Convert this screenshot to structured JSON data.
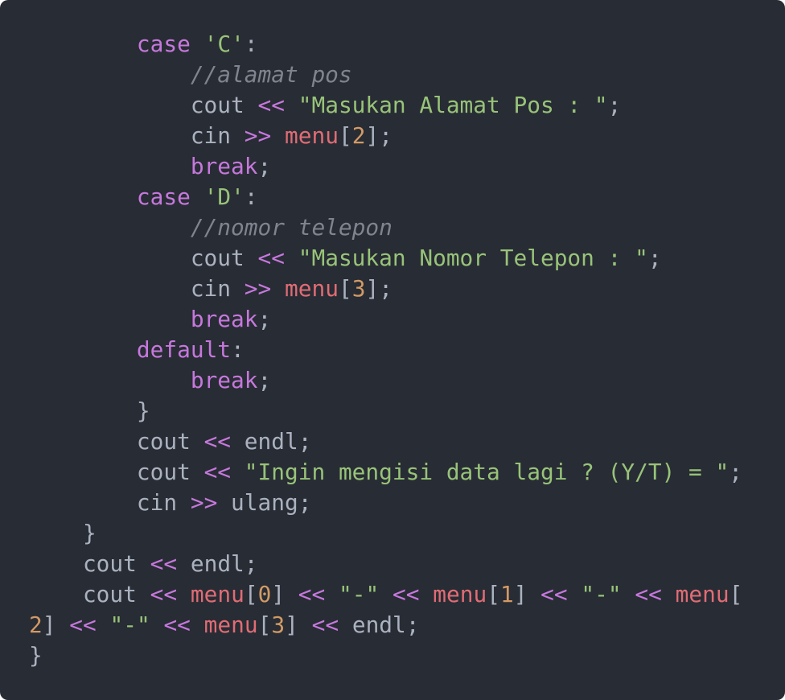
{
  "colors": {
    "background": "#282c34",
    "plain": "#abb2bf",
    "keyword": "#c678dd",
    "string": "#98c379",
    "comment": "#7f848e",
    "operator": "#c678dd",
    "variable": "#e06c75",
    "number": "#d19a66"
  },
  "lines": [
    [
      [
        "pl",
        "        "
      ],
      [
        "kw",
        "case"
      ],
      [
        "pl",
        " "
      ],
      [
        "str",
        "'C'"
      ],
      [
        "pl",
        ":"
      ]
    ],
    [
      [
        "pl",
        "            "
      ],
      [
        "cm",
        "//alamat pos"
      ]
    ],
    [
      [
        "pl",
        "            cout "
      ],
      [
        "op",
        "<<"
      ],
      [
        "pl",
        " "
      ],
      [
        "str",
        "\"Masukan Alamat Pos : \""
      ],
      [
        "pl",
        ";"
      ]
    ],
    [
      [
        "pl",
        "            cin "
      ],
      [
        "op",
        ">>"
      ],
      [
        "pl",
        " "
      ],
      [
        "var",
        "menu"
      ],
      [
        "pl",
        "["
      ],
      [
        "num",
        "2"
      ],
      [
        "pl",
        "];"
      ]
    ],
    [
      [
        "pl",
        "            "
      ],
      [
        "kw",
        "break"
      ],
      [
        "pl",
        ";"
      ]
    ],
    [
      [
        "pl",
        "        "
      ],
      [
        "kw",
        "case"
      ],
      [
        "pl",
        " "
      ],
      [
        "str",
        "'D'"
      ],
      [
        "pl",
        ":"
      ]
    ],
    [
      [
        "pl",
        "            "
      ],
      [
        "cm",
        "//nomor telepon"
      ]
    ],
    [
      [
        "pl",
        "            cout "
      ],
      [
        "op",
        "<<"
      ],
      [
        "pl",
        " "
      ],
      [
        "str",
        "\"Masukan Nomor Telepon : \""
      ],
      [
        "pl",
        ";"
      ]
    ],
    [
      [
        "pl",
        "            cin "
      ],
      [
        "op",
        ">>"
      ],
      [
        "pl",
        " "
      ],
      [
        "var",
        "menu"
      ],
      [
        "pl",
        "["
      ],
      [
        "num",
        "3"
      ],
      [
        "pl",
        "];"
      ]
    ],
    [
      [
        "pl",
        "            "
      ],
      [
        "kw",
        "break"
      ],
      [
        "pl",
        ";"
      ]
    ],
    [
      [
        "pl",
        "        "
      ],
      [
        "kw",
        "default"
      ],
      [
        "pl",
        ":"
      ]
    ],
    [
      [
        "pl",
        "            "
      ],
      [
        "kw",
        "break"
      ],
      [
        "pl",
        ";"
      ]
    ],
    [
      [
        "pl",
        "        }"
      ]
    ],
    [
      [
        "pl",
        "        cout "
      ],
      [
        "op",
        "<<"
      ],
      [
        "pl",
        " endl;"
      ]
    ],
    [
      [
        "pl",
        "        cout "
      ],
      [
        "op",
        "<<"
      ],
      [
        "pl",
        " "
      ],
      [
        "str",
        "\"Ingin mengisi data lagi ? (Y/T) = \""
      ],
      [
        "pl",
        ";"
      ]
    ],
    [
      [
        "pl",
        "        cin "
      ],
      [
        "op",
        ">>"
      ],
      [
        "pl",
        " ulang;"
      ]
    ],
    [
      [
        "pl",
        "    }"
      ]
    ],
    [
      [
        "pl",
        "    cout "
      ],
      [
        "op",
        "<<"
      ],
      [
        "pl",
        " endl;"
      ]
    ],
    [
      [
        "pl",
        "    cout "
      ],
      [
        "op",
        "<<"
      ],
      [
        "pl",
        " "
      ],
      [
        "var",
        "menu"
      ],
      [
        "pl",
        "["
      ],
      [
        "num",
        "0"
      ],
      [
        "pl",
        "] "
      ],
      [
        "op",
        "<<"
      ],
      [
        "pl",
        " "
      ],
      [
        "str",
        "\"-\""
      ],
      [
        "pl",
        " "
      ],
      [
        "op",
        "<<"
      ],
      [
        "pl",
        " "
      ],
      [
        "var",
        "menu"
      ],
      [
        "pl",
        "["
      ],
      [
        "num",
        "1"
      ],
      [
        "pl",
        "] "
      ],
      [
        "op",
        "<<"
      ],
      [
        "pl",
        " "
      ],
      [
        "str",
        "\"-\""
      ],
      [
        "pl",
        " "
      ],
      [
        "op",
        "<<"
      ],
      [
        "pl",
        " "
      ],
      [
        "var",
        "menu"
      ],
      [
        "pl",
        "["
      ]
    ],
    [
      [
        "num",
        "2"
      ],
      [
        "pl",
        "] "
      ],
      [
        "op",
        "<<"
      ],
      [
        "pl",
        " "
      ],
      [
        "str",
        "\"-\""
      ],
      [
        "pl",
        " "
      ],
      [
        "op",
        "<<"
      ],
      [
        "pl",
        " "
      ],
      [
        "var",
        "menu"
      ],
      [
        "pl",
        "["
      ],
      [
        "num",
        "3"
      ],
      [
        "pl",
        "] "
      ],
      [
        "op",
        "<<"
      ],
      [
        "pl",
        " endl;"
      ]
    ],
    [
      [
        "pl",
        "}"
      ]
    ]
  ]
}
